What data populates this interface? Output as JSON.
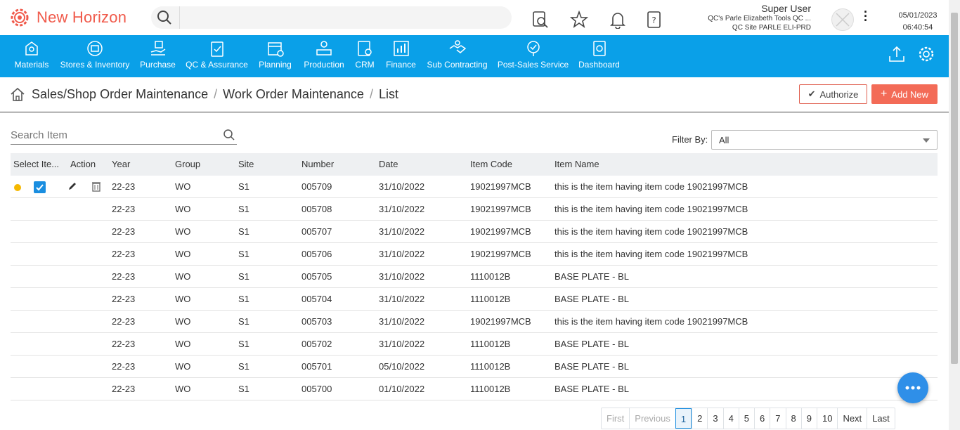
{
  "app": {
    "title": "New Horizon",
    "brand_color": "#f05a4b",
    "nav_color": "#0aa0e8"
  },
  "header": {
    "search_placeholder": "",
    "user_name": "Super User",
    "company": "QC's Parle Elizabeth Tools QC ...",
    "site": "QC Site PARLE ELI-PRD",
    "date": "05/01/2023",
    "time": "06:40:54"
  },
  "nav": {
    "items": [
      {
        "label": "Materials",
        "icon": "materials-icon"
      },
      {
        "label": "Stores & Inventory",
        "icon": "stores-icon"
      },
      {
        "label": "Purchase",
        "icon": "purchase-icon"
      },
      {
        "label": "QC & Assurance",
        "icon": "qc-icon"
      },
      {
        "label": "Planning",
        "icon": "planning-icon"
      },
      {
        "label": "Production",
        "icon": "production-icon"
      },
      {
        "label": "CRM",
        "icon": "crm-icon"
      },
      {
        "label": "Finance",
        "icon": "finance-icon"
      },
      {
        "label": "Sub Contracting",
        "icon": "handshake-icon"
      },
      {
        "label": "Post-Sales Service",
        "icon": "service-icon"
      },
      {
        "label": "Dashboard",
        "icon": "dashboard-icon"
      }
    ]
  },
  "breadcrumb": {
    "level1": "Sales/Shop Order Maintenance",
    "level2": "Work Order Maintenance",
    "level3": "List",
    "sep": "/"
  },
  "actions": {
    "authorize": "Authorize",
    "add_new": "Add New"
  },
  "search_item": {
    "placeholder": "Search Item"
  },
  "filter": {
    "label": "Filter By:",
    "value": "All"
  },
  "table": {
    "headers": {
      "select": "Select Ite...",
      "action": "Action",
      "year": "Year",
      "group": "Group",
      "site": "Site",
      "number": "Number",
      "date": "Date",
      "item_code": "Item Code",
      "item_name": "Item Name"
    },
    "rows": [
      {
        "year": "22-23",
        "group": "WO",
        "site": "S1",
        "number": "005709",
        "date": "31/10/2022",
        "code": "19021997MCB",
        "name": "this is the item having item code 19021997MCB"
      },
      {
        "year": "22-23",
        "group": "WO",
        "site": "S1",
        "number": "005708",
        "date": "31/10/2022",
        "code": "19021997MCB",
        "name": "this is the item having item code 19021997MCB"
      },
      {
        "year": "22-23",
        "group": "WO",
        "site": "S1",
        "number": "005707",
        "date": "31/10/2022",
        "code": "19021997MCB",
        "name": "this is the item having item code 19021997MCB"
      },
      {
        "year": "22-23",
        "group": "WO",
        "site": "S1",
        "number": "005706",
        "date": "31/10/2022",
        "code": "19021997MCB",
        "name": "this is the item having item code 19021997MCB"
      },
      {
        "year": "22-23",
        "group": "WO",
        "site": "S1",
        "number": "005705",
        "date": "31/10/2022",
        "code": "1110012B",
        "name": "BASE PLATE - BL"
      },
      {
        "year": "22-23",
        "group": "WO",
        "site": "S1",
        "number": "005704",
        "date": "31/10/2022",
        "code": "1110012B",
        "name": "BASE PLATE - BL"
      },
      {
        "year": "22-23",
        "group": "WO",
        "site": "S1",
        "number": "005703",
        "date": "31/10/2022",
        "code": "19021997MCB",
        "name": "this is the item having item code 19021997MCB"
      },
      {
        "year": "22-23",
        "group": "WO",
        "site": "S1",
        "number": "005702",
        "date": "31/10/2022",
        "code": "1110012B",
        "name": "BASE PLATE - BL"
      },
      {
        "year": "22-23",
        "group": "WO",
        "site": "S1",
        "number": "005701",
        "date": "05/10/2022",
        "code": "1110012B",
        "name": "BASE PLATE - BL"
      },
      {
        "year": "22-23",
        "group": "WO",
        "site": "S1",
        "number": "005700",
        "date": "01/10/2022",
        "code": "1110012B",
        "name": "BASE PLATE - BL"
      }
    ]
  },
  "pagination": {
    "first": "First",
    "previous": "Previous",
    "next": "Next",
    "last": "Last",
    "pages": [
      "1",
      "2",
      "3",
      "4",
      "5",
      "6",
      "7",
      "8",
      "9",
      "10"
    ],
    "current": "1"
  }
}
